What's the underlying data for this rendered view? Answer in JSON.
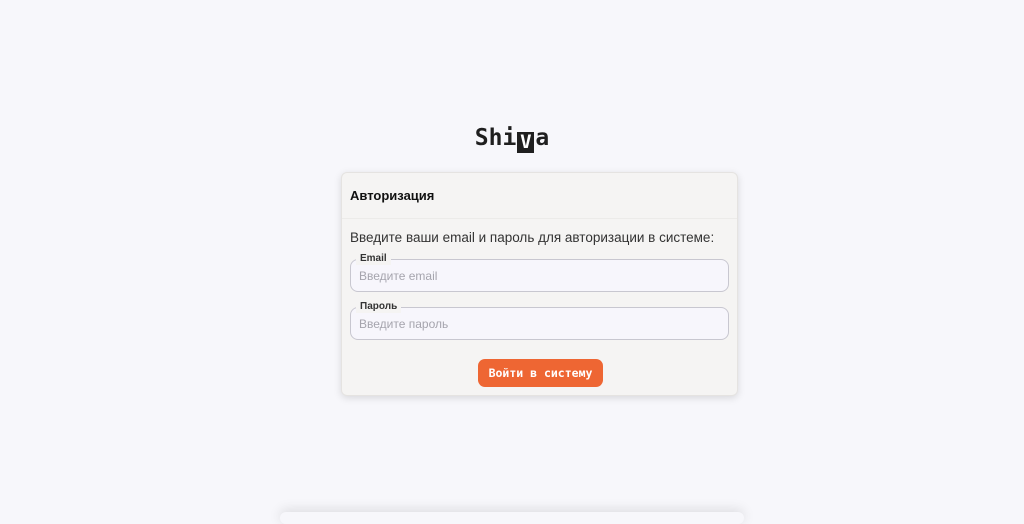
{
  "logo": {
    "prefix": "Shi",
    "mark": "V",
    "suffix": "a"
  },
  "auth": {
    "title": "Авторизация",
    "description": "Введите ваши email и пароль для авторизации в системе:",
    "email": {
      "label": "Email",
      "placeholder": "Введите email",
      "value": ""
    },
    "password": {
      "label": "Пароль",
      "placeholder": "Введите пароль",
      "value": ""
    },
    "submit_label": "Войти в систему"
  },
  "colors": {
    "accent": "#ee6633",
    "background": "#f7f7fb",
    "card": "#f5f4f3"
  }
}
